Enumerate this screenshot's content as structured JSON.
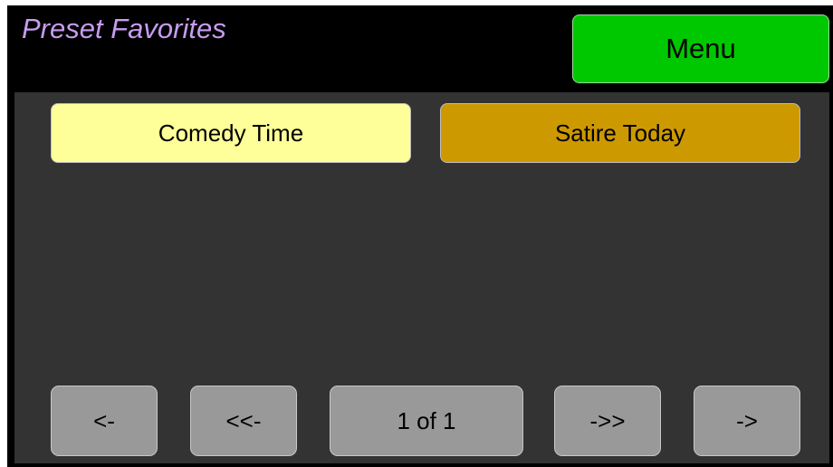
{
  "header": {
    "title": "Preset Favorites",
    "menu_label": "Menu"
  },
  "presets": [
    {
      "label": "Comedy Time",
      "selected": true,
      "color": "#ffff99"
    },
    {
      "label": "Satire Today",
      "selected": false,
      "color": "#cc9900"
    }
  ],
  "pager": {
    "prev_label": "<-",
    "first_label": "<<-",
    "page_label": "1 of 1",
    "last_label": "->>",
    "next_label": "->"
  },
  "colors": {
    "title": "#c89cf0",
    "menu_button": "#00c800",
    "panel": "#333333",
    "nav_button": "#999999"
  }
}
